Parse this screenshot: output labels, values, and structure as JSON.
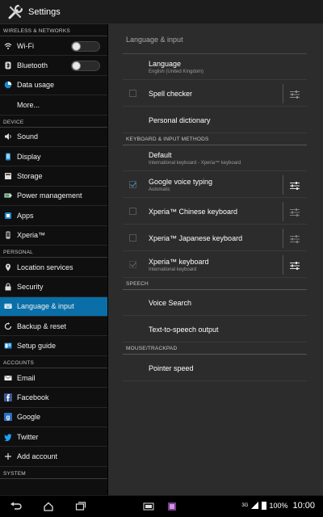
{
  "app": {
    "title": "Settings",
    "icon": "wrench-screwdriver-icon"
  },
  "sidebar": {
    "sections": [
      {
        "header": "WIRELESS & NETWORKS",
        "items": [
          {
            "label": "Wi-Fi",
            "icon": "wifi-icon",
            "toggle": false
          },
          {
            "label": "Bluetooth",
            "icon": "bluetooth-icon",
            "toggle": false
          },
          {
            "label": "Data usage",
            "icon": "data-usage-icon"
          },
          {
            "label": "More...",
            "icon": ""
          }
        ]
      },
      {
        "header": "DEVICE",
        "items": [
          {
            "label": "Sound",
            "icon": "speaker-icon"
          },
          {
            "label": "Display",
            "icon": "display-icon"
          },
          {
            "label": "Storage",
            "icon": "storage-icon"
          },
          {
            "label": "Power management",
            "icon": "battery-icon"
          },
          {
            "label": "Apps",
            "icon": "apps-icon"
          },
          {
            "label": "Xperia™",
            "icon": "xperia-icon"
          }
        ]
      },
      {
        "header": "PERSONAL",
        "items": [
          {
            "label": "Location services",
            "icon": "location-icon"
          },
          {
            "label": "Security",
            "icon": "lock-icon"
          },
          {
            "label": "Language & input",
            "icon": "keyboard-icon",
            "selected": true
          },
          {
            "label": "Backup & reset",
            "icon": "backup-icon"
          },
          {
            "label": "Setup guide",
            "icon": "setup-guide-icon"
          }
        ]
      },
      {
        "header": "ACCOUNTS",
        "items": [
          {
            "label": "Email",
            "icon": "email-icon"
          },
          {
            "label": "Facebook",
            "icon": "facebook-icon"
          },
          {
            "label": "Google",
            "icon": "google-icon"
          },
          {
            "label": "Twitter",
            "icon": "twitter-icon"
          },
          {
            "label": "Add account",
            "icon": "plus-icon"
          }
        ]
      },
      {
        "header": "SYSTEM",
        "items": []
      }
    ]
  },
  "main": {
    "title": "Language & input",
    "prefs": {
      "language": {
        "title": "Language",
        "summary": "English (United Kingdom)"
      },
      "spell_checker": {
        "title": "Spell checker",
        "checked": false
      },
      "personal_dictionary": {
        "title": "Personal dictionary"
      },
      "keyboard_header": "KEYBOARD & INPUT METHODS",
      "default": {
        "title": "Default",
        "summary": "International keyboard - Xperia™ keyboard"
      },
      "google_voice": {
        "title": "Google voice typing",
        "summary": "Automatic",
        "checked": true
      },
      "xperia_chinese": {
        "title": "Xperia™ Chinese keyboard",
        "checked": false
      },
      "xperia_japanese": {
        "title": "Xperia™ Japanese keyboard",
        "checked": false
      },
      "xperia_keyboard": {
        "title": "Xperia™ keyboard",
        "summary": "International keyboard",
        "checked": true
      },
      "speech_header": "SPEECH",
      "voice_search": {
        "title": "Voice Search"
      },
      "tts": {
        "title": "Text-to-speech output"
      },
      "mouse_header": "MOUSE/TRACKPAD",
      "pointer_speed": {
        "title": "Pointer speed"
      }
    }
  },
  "navbar": {
    "buttons": [
      "back-icon",
      "home-icon",
      "recent-apps-icon"
    ],
    "status": {
      "network": "3G",
      "battery": "100%",
      "time": "10:00"
    }
  },
  "colors": {
    "accent": "#0a6fa8",
    "check": "#3aa0e0"
  }
}
